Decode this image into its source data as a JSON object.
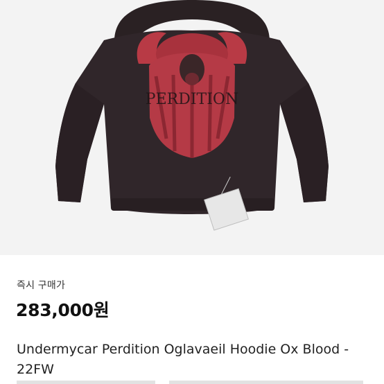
{
  "listing": {
    "purchase_type": "즉시 구매가",
    "price": "283,000원",
    "title": "Undermycar Perdition Oglavaeil Hoodie Ox Blood - 22FW"
  },
  "image": {
    "print_text": "PERDITION"
  },
  "colors": {
    "background": "#f3f3f3",
    "hoodie": "#2f2527",
    "graphic": "#b83a45"
  }
}
